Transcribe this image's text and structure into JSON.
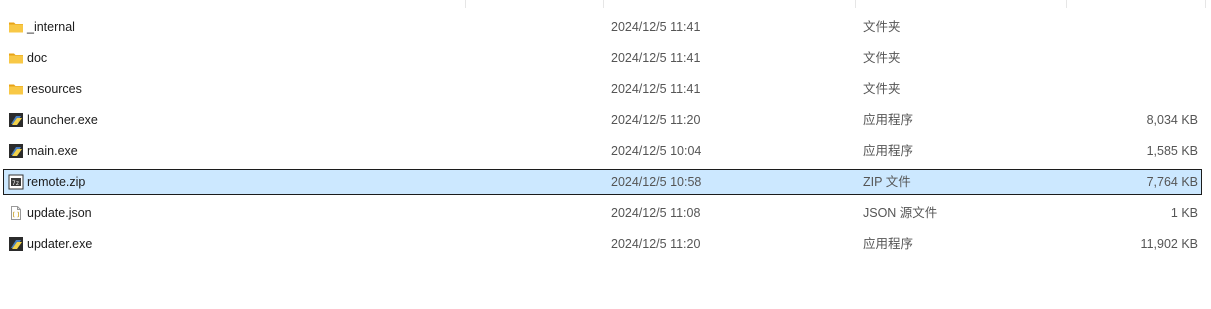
{
  "files": [
    {
      "name": "_internal",
      "date": "2024/12/5 11:41",
      "type": "文件夹",
      "size": "",
      "icon": "folder-icon"
    },
    {
      "name": "doc",
      "date": "2024/12/5 11:41",
      "type": "文件夹",
      "size": "",
      "icon": "folder-icon"
    },
    {
      "name": "resources",
      "date": "2024/12/5 11:41",
      "type": "文件夹",
      "size": "",
      "icon": "folder-icon"
    },
    {
      "name": "launcher.exe",
      "date": "2024/12/5 11:20",
      "type": "应用程序",
      "size": "8,034 KB",
      "icon": "python-exe-icon"
    },
    {
      "name": "main.exe",
      "date": "2024/12/5 10:04",
      "type": "应用程序",
      "size": "1,585 KB",
      "icon": "python-exe-icon"
    },
    {
      "name": "remote.zip",
      "date": "2024/12/5 10:58",
      "type": "ZIP 文件",
      "size": "7,764 KB",
      "icon": "zip-archive-icon",
      "selected": true
    },
    {
      "name": "update.json",
      "date": "2024/12/5 11:08",
      "type": "JSON 源文件",
      "size": "1 KB",
      "icon": "json-file-icon"
    },
    {
      "name": "updater.exe",
      "date": "2024/12/5 11:20",
      "type": "应用程序",
      "size": "11,902 KB",
      "icon": "python-exe-icon"
    }
  ],
  "colors": {
    "selection_bg": "#cce8ff",
    "selection_border": "#1c1c1c",
    "folder": "#f8c846",
    "text": "#1c1c1c",
    "secondary_text": "#555555"
  }
}
